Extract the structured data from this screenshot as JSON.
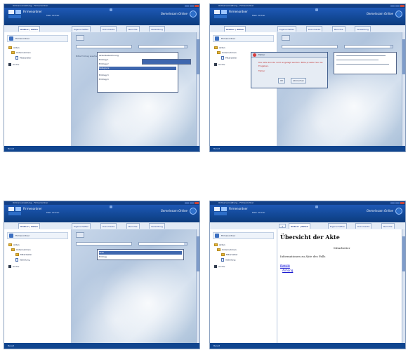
{
  "screens": [
    {
      "title": "Ordnerverwaltung - Firmenordner",
      "app": "Firmenordner",
      "nav": "Mein Ordner",
      "brand": "Gemeinsam Online",
      "tabs": [
        "Ordner | Akten",
        "Eigenschaften",
        "Dokumente",
        "Berichte",
        "Verwaltung"
      ],
      "left_header": "Firmenordner",
      "tree": [
        "Akten",
        "Unternehmen",
        "Mitarbeiter",
        "Archiv"
      ],
      "hint": "Bitte Eintrag waehlen",
      "list_items": [
        "Aktenbezeichnung",
        "Eintrag 1",
        "Eintrag 2",
        "Kategorie",
        "Eintrag 3",
        "Eintrag 4"
      ],
      "status": "Bereit"
    },
    {
      "title": "Ordnerverwaltung - Firmenordner",
      "app": "Firmenordner",
      "nav": "Mein Ordner",
      "brand": "Gemeinsam Online",
      "tabs": [
        "Ordner | Akten",
        "Eigenschaften",
        "Dokumente",
        "Berichte",
        "Verwaltung"
      ],
      "left_header": "Firmenordner",
      "tree": [
        "Akten",
        "Unternehmen",
        "Mitarbeiter",
        "Archiv"
      ],
      "dialog": {
        "title": "Fehler",
        "message": "Die Akte konnte nicht angelegt werden. Bitte pruefen Sie die Eingaben.",
        "message2": "Fehler",
        "ok": "OK",
        "cancel": "Abbrechen"
      },
      "status": "Bereit"
    },
    {
      "title": "Ordnerverwaltung - Firmenordner",
      "app": "Firmenordner",
      "nav": "Mein Ordner",
      "brand": "Gemeinsam Online",
      "tabs": [
        "Ordner | Akten",
        "Eigenschaften",
        "Dokumente",
        "Berichte",
        "Verwaltung"
      ],
      "left_header": "Firmenordner",
      "tree": [
        "Akten",
        "Unternehmen",
        "Mitarbeiter",
        "Abteilung",
        "Archiv"
      ],
      "list_items": [
        "Akte",
        "Eintrag"
      ],
      "status": "Bereit"
    },
    {
      "title": "Ordnerverwaltung - Firmenordner",
      "app": "Firmenordner",
      "nav": "Mein Ordner",
      "brand": "Gemeinsam Online",
      "tabs": [
        "Ordner | Akten",
        "Eigenschaften",
        "Dokumente",
        "Berichte",
        "Verwaltung"
      ],
      "left_header": "Firmenordner",
      "tree": [
        "Akten",
        "Unternehmen",
        "Mitarbeiter",
        "Abteilung",
        "Archiv"
      ],
      "doc_title": "Übersicht der Akte",
      "doc_right": "Mitarbeiter",
      "doc_line": "Informationen zu Akte des Falls",
      "doc_link": "Details",
      "doc_sub": "Anhang",
      "status": "Bereit"
    }
  ]
}
